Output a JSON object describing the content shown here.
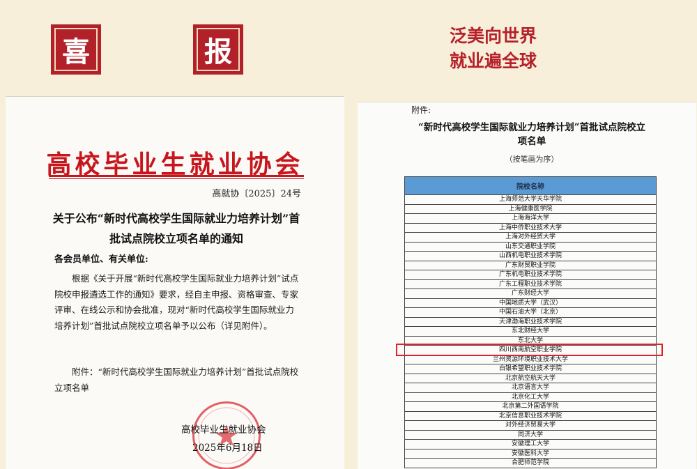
{
  "header": {
    "badge_left": "喜",
    "badge_right": "报",
    "slogan_line1": "泛美向世界",
    "slogan_line2": "就业遍全球"
  },
  "notice": {
    "org_title": "高校毕业生就业协会",
    "doc_number": "高就协〔2025〕24号",
    "title": "关于公布“新时代高校学生国际就业力培养计划”首批试点院校立项名单的通知",
    "recipient": "各会员单位、有关单位:",
    "body": "根据《关于开展“新时代高校学生国际就业力培养计划”试点院校申报遴选工作的通知》要求，经自主申报、资格审查、专家评审、在线公示和协会批准，现对“新时代高校学生国际就业力培养计划”首批试点院校立项名单予以公布（详见附件）。",
    "attachment": "附件：“新时代高校学生国际就业力培养计划”首批试点院校立项名单",
    "signer": "高校毕业生就业协会",
    "date": "2025年6月18日"
  },
  "list": {
    "attachment_label": "附件:",
    "title_line1": "“新时代高校学生国际就业力培养计划”首批试点院校立",
    "title_line2": "项名单",
    "order_note": "（按笔画为序）",
    "column_header": "院校名称",
    "schools": [
      "上海师范大学天华学院",
      "上海健康医学院",
      "上海海洋大学",
      "上海中侨职业技术大学",
      "上海对外经贸大学",
      "山东交通职业学院",
      "山西机电职业技术学院",
      "广东财贸职业学院",
      "广东机电职业技术学院",
      "广东工程职业技术学院",
      "广东财经大学",
      "中国地质大学（武汉）",
      "中国石油大学（北京）",
      "天津渤海职业技术学院",
      "东北财经大学",
      "东北大学",
      "四川西南航空职业学院",
      "兰州资源环境职业技术大学",
      "白银希望职业技术学院",
      "北京航空航天大学",
      "北京语言大学",
      "北京化工大学",
      "北京第二外国语学院",
      "北京信息职业技术学院",
      "对外经济贸易大学",
      "同济大学",
      "安徽理工大学",
      "安徽医科大学",
      "合肥师范学院"
    ],
    "highlighted_index": 16
  },
  "colors": {
    "background": "#f7efd9",
    "badge_red": "#b2202a",
    "slogan_red": "#b5202a",
    "header_red": "#c8161d",
    "table_header_blue": "#5b9bd5",
    "highlight": "#e0232b"
  }
}
